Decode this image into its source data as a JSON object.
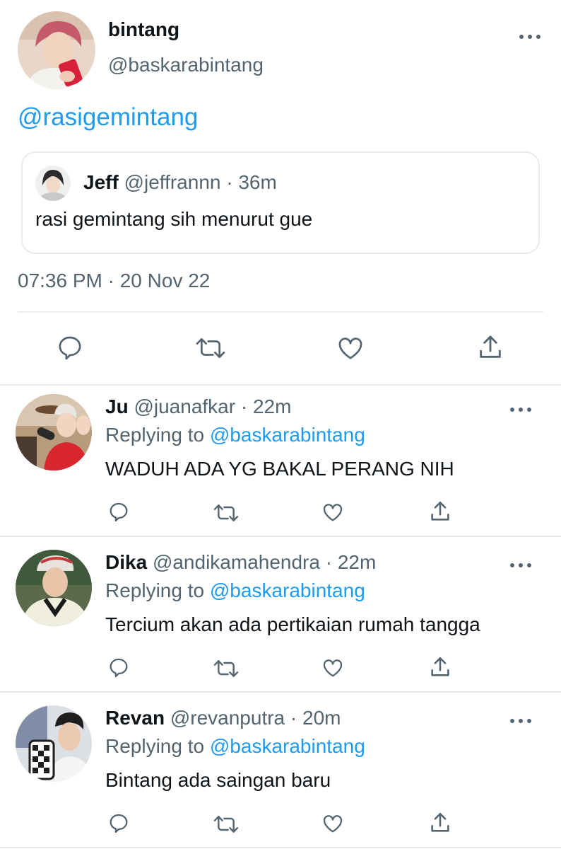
{
  "main_tweet": {
    "display_name": "bintang",
    "handle": "@baskarabintang",
    "text": "@rasigemintang",
    "quoted": {
      "display_name": "Jeff",
      "handle": "@jeffrannn",
      "separator": "·",
      "time": "36m",
      "text": "rasi gemintang sih menurut gue"
    },
    "timestamp": "07:36 PM · 20 Nov 22",
    "actions": [
      "reply-icon",
      "retweet-icon",
      "like-icon",
      "share-icon"
    ]
  },
  "replies": [
    {
      "display_name": "Ju",
      "handle": "@juanafkar",
      "separator": "·",
      "time": "22m",
      "replying_label": "Replying to",
      "replying_to": "@baskarabintang",
      "text": "WADUH ADA YG BAKAL PERANG NIH"
    },
    {
      "display_name": "Dika",
      "handle": "@andikamahendra",
      "separator": "·",
      "time": "22m",
      "replying_label": "Replying to",
      "replying_to": "@baskarabintang",
      "text": "Tercium akan ada pertikaian rumah tangga"
    },
    {
      "display_name": "Revan",
      "handle": "@revanputra",
      "separator": "·",
      "time": "20m",
      "replying_label": "Replying to",
      "replying_to": "@baskarabintang",
      "text": "Bintang ada saingan baru"
    }
  ],
  "colors": {
    "link": "#1d9bf0",
    "secondary_text": "#536471",
    "divider": "#e6ecf0"
  }
}
